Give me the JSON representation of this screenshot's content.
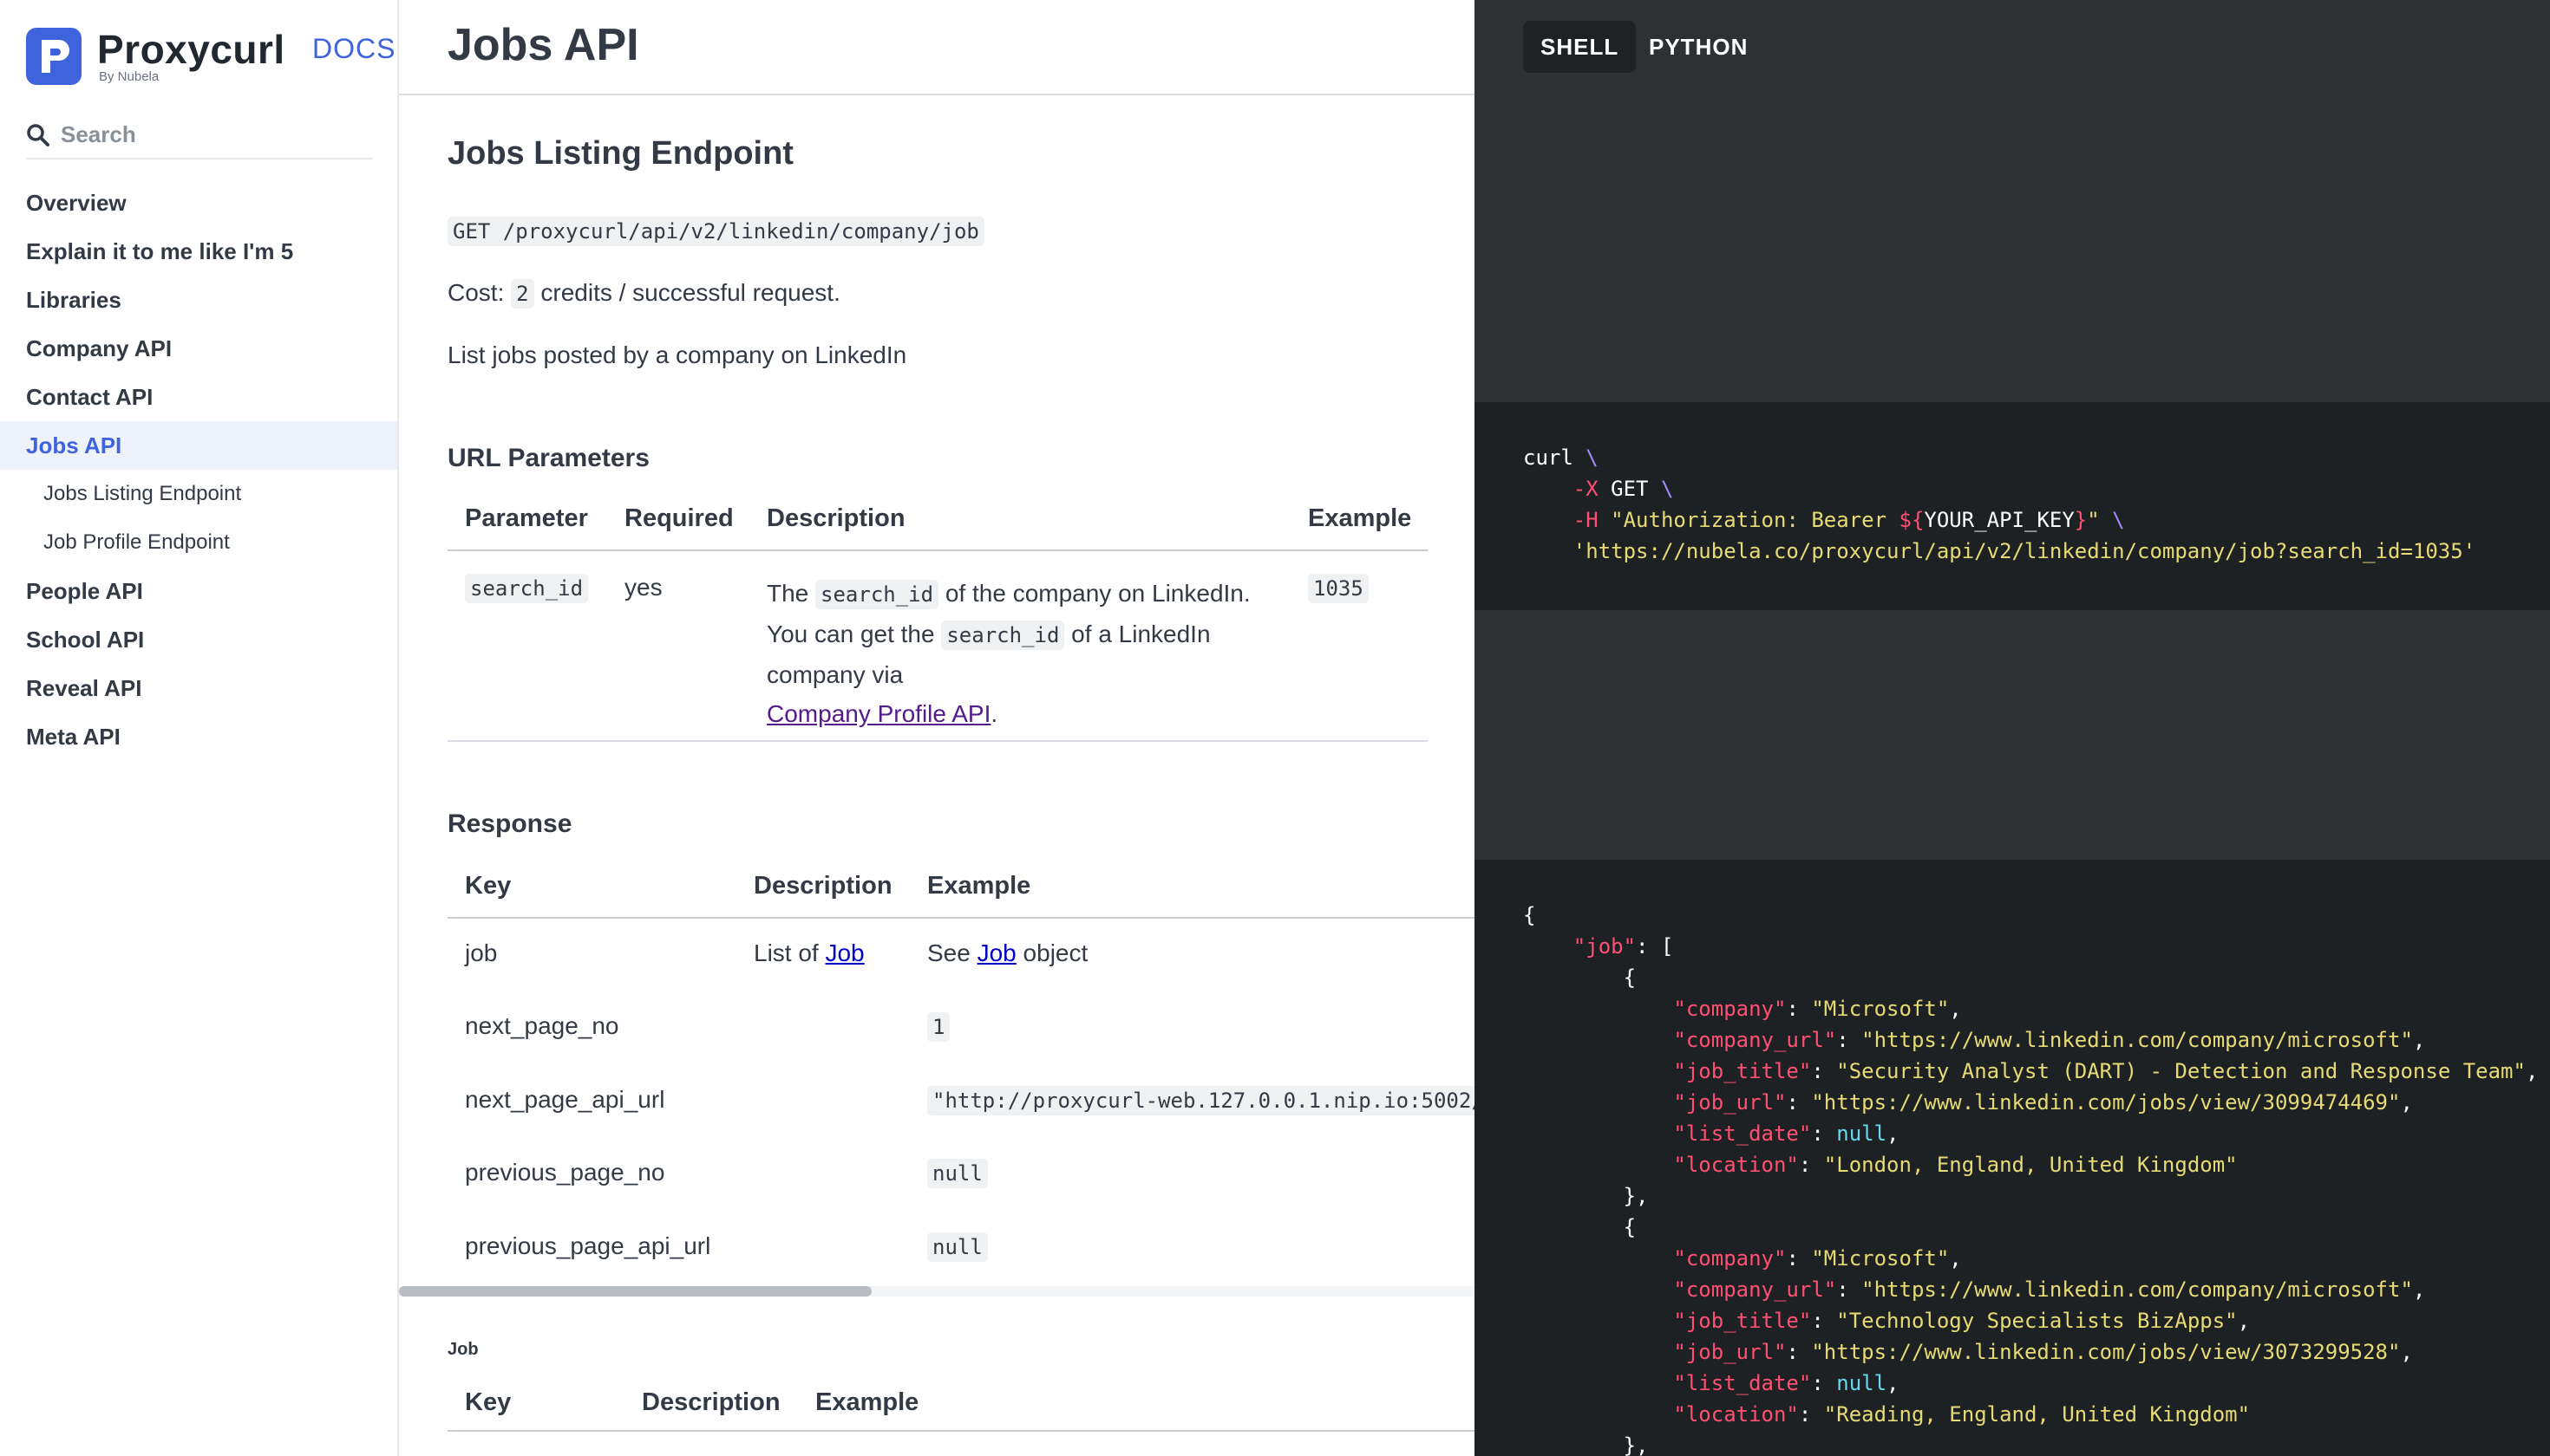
{
  "brand": {
    "name": "Proxycurl",
    "byline": "By Nubela",
    "docs_label": "DOCS"
  },
  "search": {
    "placeholder": "Search"
  },
  "nav": {
    "items": [
      {
        "label": "Overview"
      },
      {
        "label": "Explain it to me like I'm 5"
      },
      {
        "label": "Libraries"
      },
      {
        "label": "Company API"
      },
      {
        "label": "Contact API"
      },
      {
        "label": "Jobs API"
      },
      {
        "label": "Jobs Listing Endpoint"
      },
      {
        "label": "Job Profile Endpoint"
      },
      {
        "label": "People API"
      },
      {
        "label": "School API"
      },
      {
        "label": "Reveal API"
      },
      {
        "label": "Meta API"
      }
    ]
  },
  "main": {
    "title": "Jobs API",
    "section_title": "Jobs Listing Endpoint",
    "endpoint": "GET /proxycurl/api/v2/linkedin/company/job",
    "cost_prefix": "Cost: ",
    "cost_value": "2",
    "cost_suffix": " credits / successful request.",
    "summary": "List jobs posted by a company on LinkedIn",
    "url_params": {
      "heading": "URL Parameters",
      "columns": [
        "Parameter",
        "Required",
        "Description",
        "Example"
      ],
      "row": {
        "parameter": "search_id",
        "required": "yes",
        "desc_1a": "The ",
        "desc_1code": "search_id",
        "desc_1b": " of the company on LinkedIn.",
        "desc_2a": "You can get the ",
        "desc_2code": "search_id",
        "desc_2b": " of a LinkedIn",
        "desc_3": "company via",
        "desc_link": "Company Profile API",
        "desc_end": ".",
        "example": "1035"
      }
    },
    "response": {
      "heading": "Response",
      "columns": [
        "Key",
        "Description",
        "Example"
      ],
      "rows": [
        {
          "key": "job",
          "desc_prefix": "List of ",
          "desc_link": "Job",
          "ex_prefix": "See ",
          "ex_link": "Job",
          "ex_suffix": " object"
        },
        {
          "key": "next_page_no",
          "example": "1"
        },
        {
          "key": "next_page_api_url",
          "example": "\"http://proxycurl-web.127.0.0.1.nip.io:5002/"
        },
        {
          "key": "previous_page_no",
          "example": "null"
        },
        {
          "key": "previous_page_api_url",
          "example": "null"
        }
      ]
    },
    "job_obj": {
      "heading": "Job",
      "columns": [
        "Key",
        "Description",
        "Example"
      ]
    }
  },
  "code": {
    "tabs": [
      "SHELL",
      "PYTHON"
    ],
    "request": {
      "l1": "curl",
      "backslash": "\\",
      "flag_x": "-X",
      "method": "GET",
      "flag_h": "-H",
      "header_open": "\"Authorization: Bearer ",
      "var_open": "${",
      "var_name": "YOUR_API_KEY",
      "var_close": "}",
      "header_close": "\"",
      "url": "'https://nubela.co/proxycurl/api/v2/linkedin/company/job?search_id=1035'"
    },
    "response": {
      "jobs": [
        {
          "company": "\"Microsoft\"",
          "company_url": "\"https://www.linkedin.com/company/microsoft\"",
          "job_title": "\"Security Analyst (DART) - Detection and Response Team\"",
          "job_url": "\"https://www.linkedin.com/jobs/view/3099474469\"",
          "list_date": "null",
          "location": "\"London, England, United Kingdom\""
        },
        {
          "company": "\"Microsoft\"",
          "company_url": "\"https://www.linkedin.com/company/microsoft\"",
          "job_title": "\"Technology Specialists BizApps\"",
          "job_url": "\"https://www.linkedin.com/jobs/view/3073299528\"",
          "list_date": "null",
          "location": "\"Reading, England, United Kingdom\""
        }
      ]
    }
  },
  "colors": {
    "accent": "#3e63dd",
    "code_bg": "#2d3134",
    "code_block_bg": "#1e2124",
    "json_key": "#ff4f73",
    "json_string": "#e6db74",
    "json_null": "#66d9ef"
  }
}
